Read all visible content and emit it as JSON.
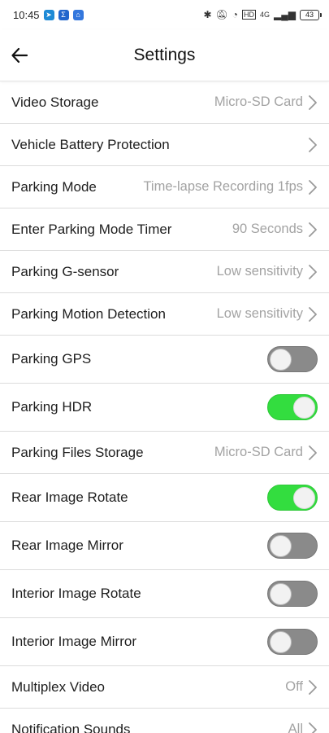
{
  "status": {
    "time": "10:45",
    "battery": "43",
    "network": "4G"
  },
  "header": {
    "title": "Settings"
  },
  "settings": [
    {
      "label": "Video Storage",
      "type": "nav",
      "value": "Micro-SD Card"
    },
    {
      "label": "Vehicle Battery Protection",
      "type": "nav",
      "value": ""
    },
    {
      "label": "Parking Mode",
      "type": "nav",
      "value": "Time-lapse Recording 1fps"
    },
    {
      "label": "Enter Parking Mode Timer",
      "type": "nav",
      "value": "90 Seconds"
    },
    {
      "label": "Parking G-sensor",
      "type": "nav",
      "value": "Low sensitivity"
    },
    {
      "label": "Parking Motion Detection",
      "type": "nav",
      "value": "Low sensitivity"
    },
    {
      "label": "Parking GPS",
      "type": "toggle",
      "on": false
    },
    {
      "label": "Parking HDR",
      "type": "toggle",
      "on": true
    },
    {
      "label": "Parking Files Storage",
      "type": "nav",
      "value": "Micro-SD Card"
    },
    {
      "label": "Rear Image Rotate",
      "type": "toggle",
      "on": true
    },
    {
      "label": "Rear Image Mirror",
      "type": "toggle",
      "on": false
    },
    {
      "label": "Interior Image Rotate",
      "type": "toggle",
      "on": false
    },
    {
      "label": "Interior Image Mirror",
      "type": "toggle",
      "on": false
    },
    {
      "label": "Multiplex Video",
      "type": "nav",
      "value": "Off"
    },
    {
      "label": "Notification Sounds",
      "type": "nav",
      "value": "All"
    }
  ],
  "colors": {
    "toggle_on": "#33dd3f",
    "toggle_off": "#8a8a8a",
    "value_text": "#a3a3a3"
  }
}
